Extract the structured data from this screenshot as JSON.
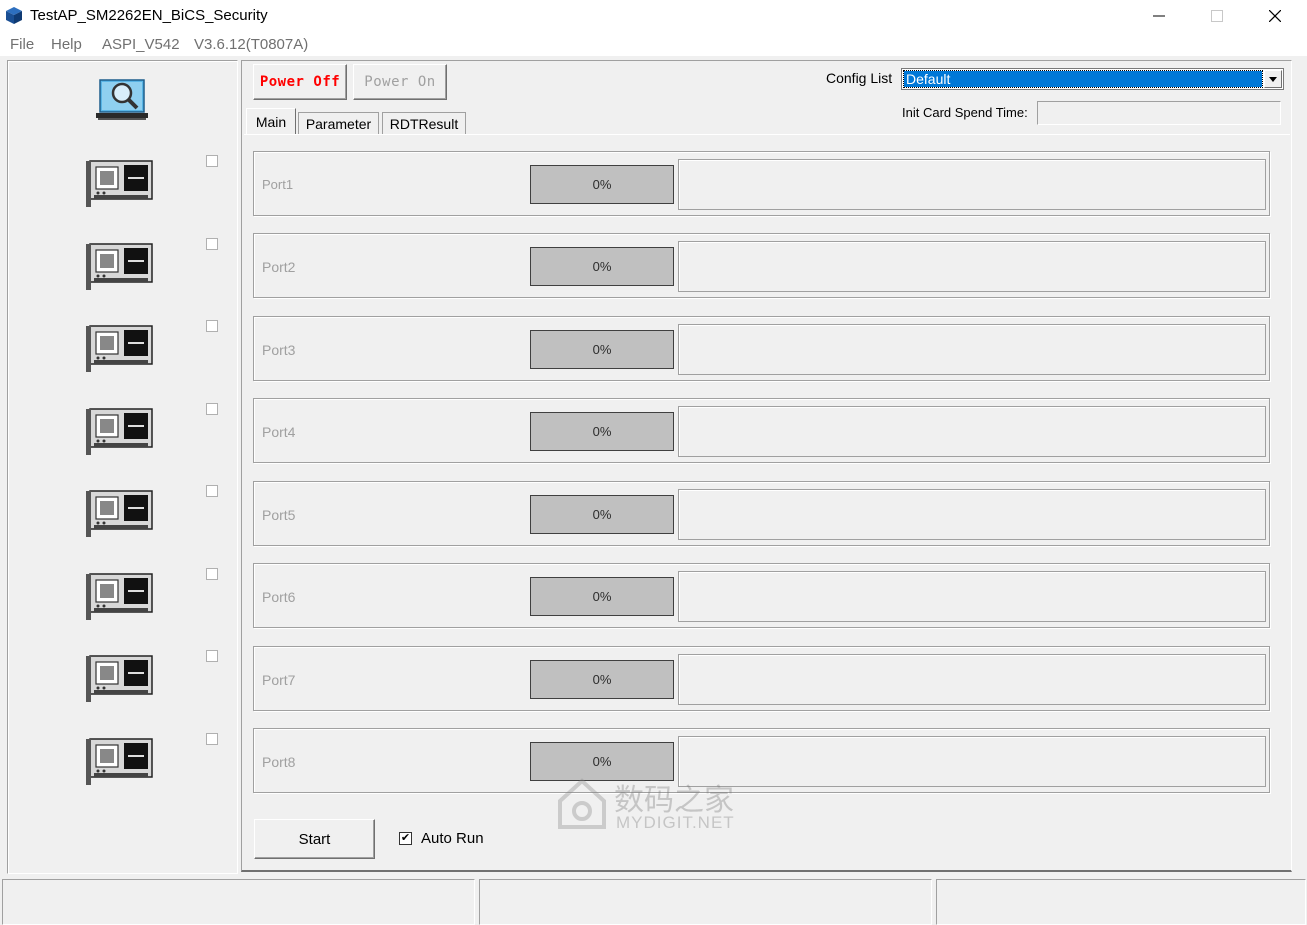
{
  "window": {
    "title": "TestAP_SM2262EN_BiCS_Security",
    "controls": {
      "minimize": "—",
      "maximize": "☐",
      "close": "✕"
    }
  },
  "menu": {
    "items": [
      "File",
      "Help",
      "ASPI_V542",
      "V3.6.12(T0807A)"
    ]
  },
  "toolbar": {
    "power_off_label": "Power Off",
    "power_on_label": "Power On",
    "power_off_color": "#ff0000",
    "power_on_color": "#a0a0a0"
  },
  "config": {
    "label": "Config List",
    "selected": "Default",
    "init_label": "Init Card Spend Time:",
    "init_value": ""
  },
  "tabs": [
    {
      "label": "Main",
      "active": true
    },
    {
      "label": "Parameter",
      "active": false
    },
    {
      "label": "RDTResult",
      "active": false
    }
  ],
  "ports": [
    {
      "label": "Port1",
      "progress": "0%"
    },
    {
      "label": "Port2",
      "progress": "0%"
    },
    {
      "label": "Port3",
      "progress": "0%"
    },
    {
      "label": "Port4",
      "progress": "0%"
    },
    {
      "label": "Port5",
      "progress": "0%"
    },
    {
      "label": "Port6",
      "progress": "0%"
    },
    {
      "label": "Port7",
      "progress": "0%"
    },
    {
      "label": "Port8",
      "progress": "0%"
    }
  ],
  "slots": [
    {
      "checked": false
    },
    {
      "checked": false
    },
    {
      "checked": false
    },
    {
      "checked": false
    },
    {
      "checked": false
    },
    {
      "checked": false
    },
    {
      "checked": false
    },
    {
      "checked": false
    }
  ],
  "actions": {
    "start_label": "Start",
    "auto_run_label": "Auto Run",
    "auto_run_checked": true
  },
  "watermark": {
    "text_cn": "数码之家",
    "text_en": "MYDIGIT.NET"
  }
}
